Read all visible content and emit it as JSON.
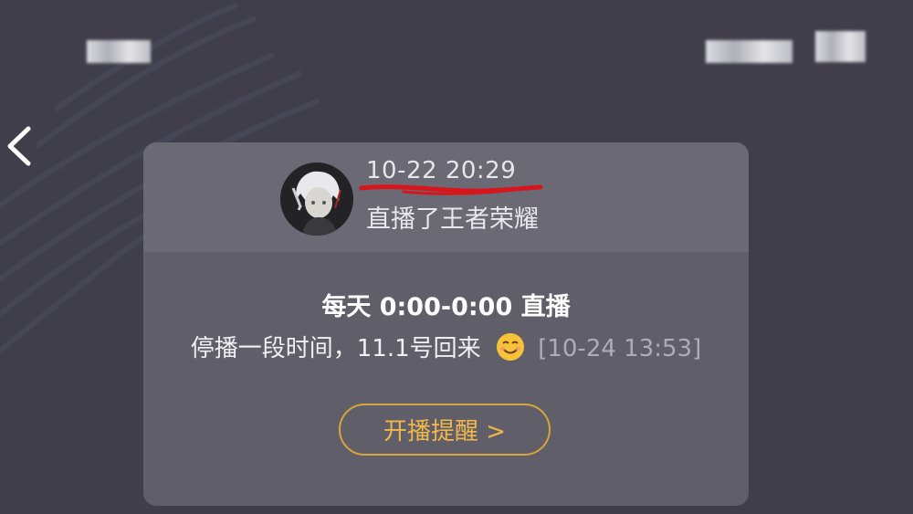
{
  "header": {
    "back_icon": "chevron-left-icon"
  },
  "post": {
    "timestamp": "10-22 20:29",
    "live_description": "直播了王者荣耀",
    "avatar_icon": "anime-avatar"
  },
  "message": {
    "schedule": "每天 0:00-0:00 直播",
    "notice_text": "停播一段时间，11.1号回来",
    "notice_emoji_icon": "smiling-face-icon",
    "notice_time": "[10-24 13:53]"
  },
  "actions": {
    "remind_label": "开播提醒 >"
  },
  "colors": {
    "background": "#3f3e4a",
    "card": "#5f5e69",
    "accent": "#d8a43d",
    "annotation": "#d6161c"
  }
}
